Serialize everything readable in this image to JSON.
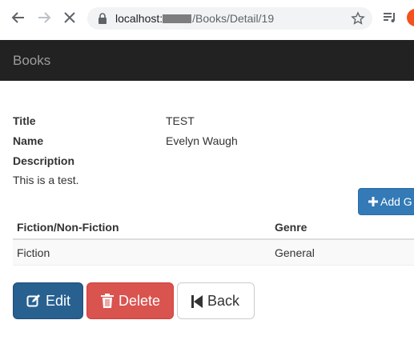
{
  "browser": {
    "url_host": "localhost:",
    "url_path": "/Books/Detail/19"
  },
  "navbar": {
    "brand": "Books"
  },
  "details": {
    "title_label": "Title",
    "title_value": "TEST",
    "name_label": "Name",
    "name_value": "Evelyn Waugh",
    "description_label": "Description",
    "description_value": "This is a test."
  },
  "add_genre_button": "Add G",
  "table": {
    "headers": [
      "Fiction/Non-Fiction",
      "Genre"
    ],
    "rows": [
      [
        "Fiction",
        "General"
      ]
    ]
  },
  "actions": {
    "edit": "Edit",
    "delete": "Delete",
    "back": "Back"
  },
  "colors": {
    "navbar_bg": "#222222",
    "primary": "#337ab7",
    "danger": "#d9534f",
    "edit": "#286090",
    "profile": "#f4511e"
  },
  "icons": {
    "back": "arrow-left-icon",
    "forward": "arrow-right-icon",
    "stop": "close-icon",
    "lock": "lock-icon",
    "bookmark": "star-icon",
    "media": "playlist-icon",
    "add": "plus-icon",
    "edit": "edit-icon",
    "delete": "trash-icon",
    "back_button": "step-backward-icon"
  }
}
